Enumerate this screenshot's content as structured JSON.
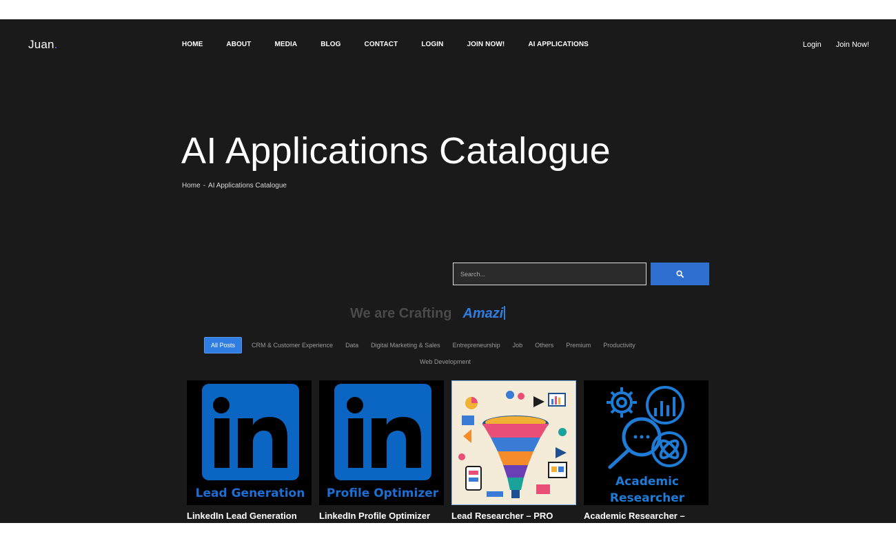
{
  "logo": {
    "text": "Juan",
    "dot": "."
  },
  "nav": {
    "items": [
      "HOME",
      "ABOUT",
      "MEDIA",
      "BLOG",
      "CONTACT",
      "LOGIN",
      "JOIN NOW!",
      "AI APPLICATIONS"
    ]
  },
  "header_right": {
    "login": "Login",
    "join": "Join Now!"
  },
  "hero": {
    "title": "AI Applications Catalogue",
    "breadcrumb_home": "Home",
    "breadcrumb_sep": "-",
    "breadcrumb_current": "AI Applications Catalogue"
  },
  "search": {
    "placeholder": "Search...",
    "icon": "search-icon"
  },
  "crafting": {
    "static": "We are Crafting",
    "typed": "Amazi"
  },
  "filters": {
    "row1": [
      "All Posts",
      "CRM & Customer Experience",
      "Data",
      "Digital Marketing & Sales",
      "Entrepreneurship",
      "Job",
      "Others",
      "Premium",
      "Productivity"
    ],
    "row2": [
      "Web Development"
    ],
    "active": "All Posts"
  },
  "cards": [
    {
      "title": "LinkedIn Lead Generation",
      "image_caption": "Lead Generation",
      "image_mark": "in"
    },
    {
      "title": "LinkedIn Profile Optimizer",
      "image_caption": "Profile Optimizer",
      "image_mark": "in"
    },
    {
      "title": "Lead Researcher – PRO",
      "image_caption": "",
      "image_mark": ""
    },
    {
      "title": "Academic Researcher –",
      "image_caption_line1": "Academic",
      "image_caption_line2": "Researcher",
      "image_mark": ""
    }
  ],
  "colors": {
    "background": "#1a1a1b",
    "accent": "#2f7de0",
    "linkedin_blue": "#0a66c2"
  }
}
